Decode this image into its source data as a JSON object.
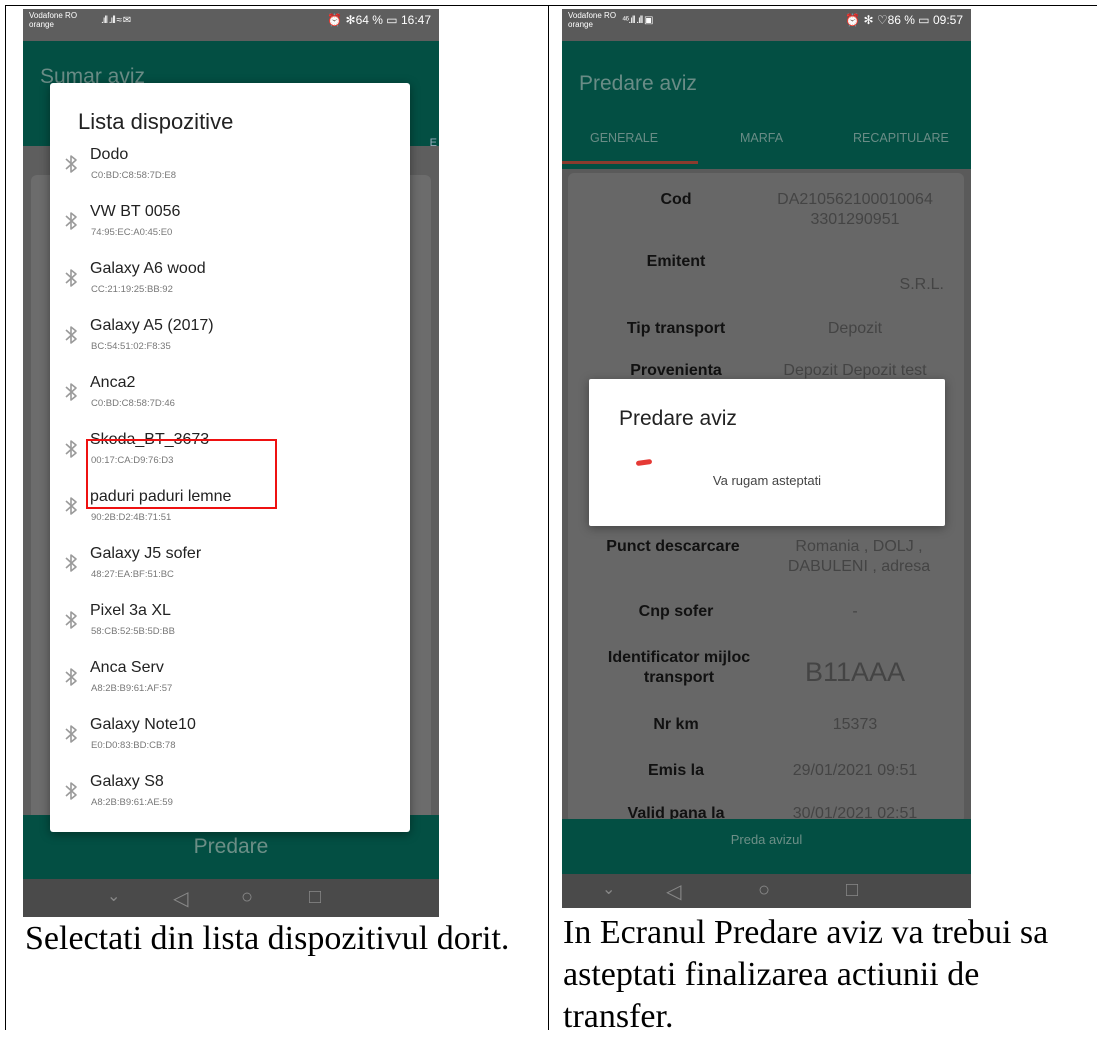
{
  "left_screen": {
    "status": {
      "carrier_line1": "Vodafone RO",
      "carrier_line2": "orange",
      "signal": ".ıll .ıll ≈ ✉",
      "right": "⏰ ✻64 % ▭ 16:47"
    },
    "app_title": "Sumar aviz",
    "tab_hint": "E",
    "dialog_title": "Lista dispozitive",
    "devices": [
      {
        "name": "Dodo",
        "mac": "C0:BD:C8:58:7D:E8"
      },
      {
        "name": "VW BT 0056",
        "mac": "74:95:EC:A0:45:E0"
      },
      {
        "name": "Galaxy A6 wood",
        "mac": "CC:21:19:25:BB:92"
      },
      {
        "name": "Galaxy A5 (2017)",
        "mac": "BC:54:51:02:F8:35"
      },
      {
        "name": "Anca2",
        "mac": "C0:BD:C8:58:7D:46"
      },
      {
        "name": "Skoda_BT_3673",
        "mac": "00:17:CA:D9:76:D3"
      },
      {
        "name": "paduri paduri lemne",
        "mac": "90:2B:D2:4B:71:51"
      },
      {
        "name": "Galaxy J5 sofer",
        "mac": "48:27:EA:BF:51:BC"
      },
      {
        "name": "Pixel 3a XL",
        "mac": "58:CB:52:5B:5D:BB"
      },
      {
        "name": "Anca Serv",
        "mac": "A8:2B:B9:61:AF:57"
      },
      {
        "name": "Galaxy Note10",
        "mac": "E0:D0:83:BD:CB:78"
      },
      {
        "name": "Galaxy S8",
        "mac": "A8:2B:B9:61:AE:59"
      }
    ],
    "bottom_button": "Predare"
  },
  "right_screen": {
    "status": {
      "carrier_line1": "Vodafone RO",
      "carrier_line2": "orange",
      "signal": "⁴⁶.ıll .ıll ▣",
      "right": "⏰ ✻ ♡86 % ▭ 09:57"
    },
    "app_title": "Predare aviz",
    "tabs": [
      "GENERALE",
      "MARFA",
      "RECAPITULARE"
    ],
    "rows": [
      {
        "label": "Cod",
        "value": "DA210562100010064 3301290951"
      },
      {
        "label": "Emitent",
        "value": "S.R.L."
      },
      {
        "label": "Tip transport",
        "value": "Depozit"
      },
      {
        "label": "Provenienta",
        "value": "Depozit Depozit test"
      },
      {
        "label": "Punct descarcare",
        "value": "Romania , DOLJ , DABULENI , adresa"
      },
      {
        "label": "Cnp sofer",
        "value": "-"
      },
      {
        "label": "Identificator mijloc transport",
        "value": "B11AAA"
      },
      {
        "label": "Nr km",
        "value": "15373"
      },
      {
        "label": "Emis la",
        "value": "29/01/2021 09:51"
      },
      {
        "label": "Valid pana la",
        "value": "30/01/2021 02:51"
      }
    ],
    "dialog_title": "Predare aviz",
    "dialog_message": "Va rugam asteptati",
    "bottom_button": "Preda avizul"
  },
  "captions": {
    "left": "Selectati din lista dispozitivul dorit.",
    "right": "In Ecranul Predare aviz va trebui sa asteptati finalizarea actiunii de transfer."
  },
  "nav_icons": [
    "chevron-down-icon",
    "back-icon",
    "home-icon",
    "recents-icon"
  ],
  "colors": {
    "app_green": "#034f43",
    "selection_red": "#e11111",
    "spinner_red": "#e53935"
  }
}
